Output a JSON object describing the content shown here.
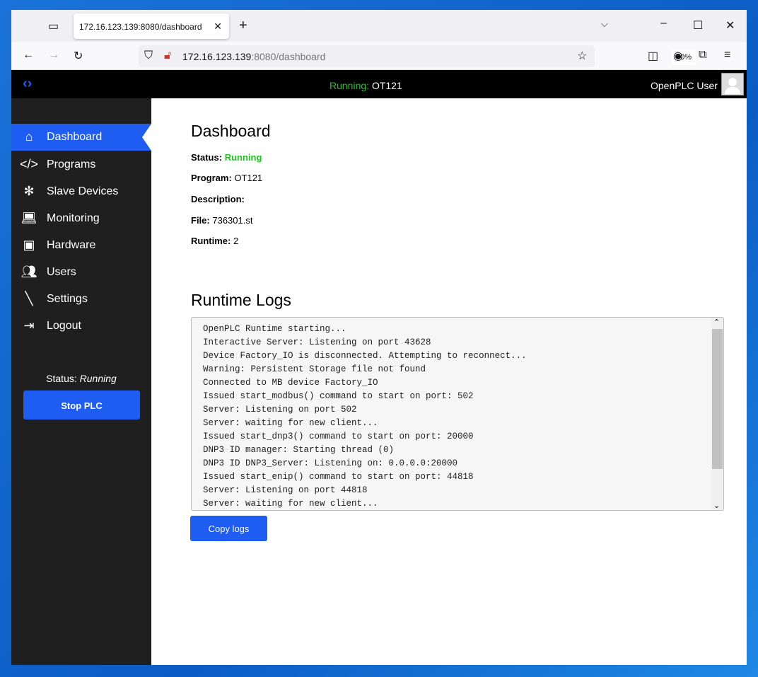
{
  "browser": {
    "tab_title": "172.16.123.139:8080/dashboard",
    "url_host": "172.16.123.139",
    "url_rest": ":8080/dashboard",
    "zoom": "80%"
  },
  "header": {
    "running_label": "Running:",
    "program": "OT121",
    "user": "OpenPLC User"
  },
  "sidebar": {
    "items": [
      {
        "label": "Dashboard",
        "icon": "home-icon"
      },
      {
        "label": "Programs",
        "icon": "code-icon"
      },
      {
        "label": "Slave Devices",
        "icon": "network-icon"
      },
      {
        "label": "Monitoring",
        "icon": "laptop-icon"
      },
      {
        "label": "Hardware",
        "icon": "chip-icon"
      },
      {
        "label": "Users",
        "icon": "users-icon"
      },
      {
        "label": "Settings",
        "icon": "screwdriver-icon"
      },
      {
        "label": "Logout",
        "icon": "logout-icon"
      }
    ],
    "status_label": "Status:",
    "status_value": "Running",
    "stop_button": "Stop PLC"
  },
  "dashboard": {
    "title": "Dashboard",
    "status_label": "Status:",
    "status_value": "Running",
    "program_label": "Program:",
    "program_value": "OT121",
    "description_label": "Description:",
    "file_label": "File:",
    "file_value": "736301.st",
    "runtime_label": "Runtime:",
    "runtime_value": "2"
  },
  "logs": {
    "title": "Runtime Logs",
    "copy_button": "Copy logs",
    "lines": [
      "OpenPLC Runtime starting...",
      "Interactive Server: Listening on port 43628",
      "Device Factory_IO is disconnected. Attempting to reconnect...",
      "Warning: Persistent Storage file not found",
      "Connected to MB device Factory_IO",
      "Issued start_modbus() command to start on port: 502",
      "Server: Listening on port 502",
      "Server: waiting for new client...",
      "Issued start_dnp3() command to start on port: 20000",
      "DNP3 ID manager: Starting thread (0)",
      "DNP3 ID DNP3_Server: Listening on: 0.0.0.0:20000",
      "Issued start_enip() command to start on port: 44818",
      "Server: Listening on port 44818",
      "Server: waiting for new client..."
    ]
  },
  "colors": {
    "accent": "#1f5cf2",
    "running": "#22c222"
  }
}
